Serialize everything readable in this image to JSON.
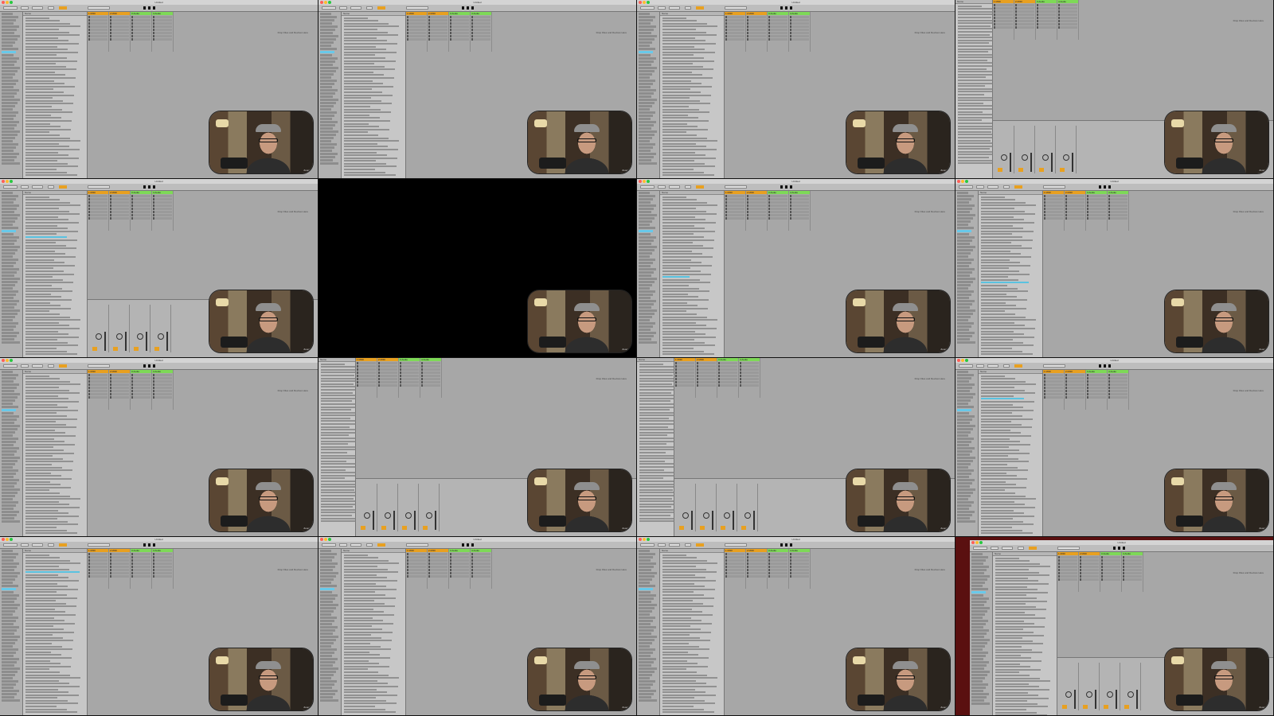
{
  "app": {
    "window_title": "Untitled",
    "browser_header": "Name",
    "drop_hint": "Drop Files and Devices Here",
    "tracks": [
      "1 MIDI",
      "2 MIDI",
      "3 Audio",
      "4 Audio"
    ],
    "webcam_label": "Zoom"
  },
  "colors": {
    "ui_gray": "#9b9b9b",
    "selection": "#68c9ea",
    "accent_orange": "#e8a020",
    "close": "#ff5f57",
    "minimize": "#febc2e",
    "maximize": "#28c840"
  },
  "layout_note": "4x4 grid of video frames showing an Ableton Live session view with a webcam overlay",
  "icons": [
    "close-dot-icon",
    "minimize-dot-icon",
    "maximize-dot-icon",
    "play-icon",
    "stop-icon",
    "knob-icon"
  ]
}
